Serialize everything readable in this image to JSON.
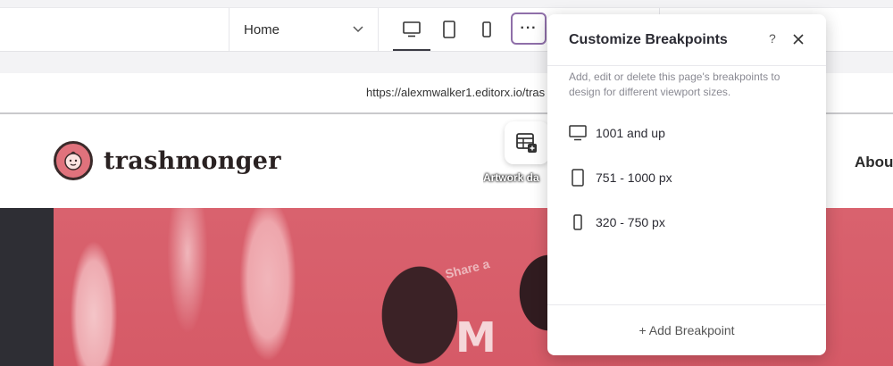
{
  "toolbar": {
    "page_selector": {
      "value": "Home"
    },
    "devices": [
      {
        "name": "desktop",
        "active": true
      },
      {
        "name": "tablet",
        "active": false
      },
      {
        "name": "mobile",
        "active": false
      }
    ],
    "more_label": "···"
  },
  "url_bar": {
    "url": "https://alexmwalker1.editorx.io/tras"
  },
  "site": {
    "logo_text": "trashmonger",
    "artwork_label": "Artwork da",
    "nav_about": "Abou",
    "hero_text": "M",
    "hero_small": "Share a"
  },
  "popover": {
    "title": "Customize Breakpoints",
    "help": "?",
    "description": "Add, edit or delete this page's breakpoints to design for different viewport sizes.",
    "breakpoints": [
      {
        "label": "1001 and up",
        "icon": "desktop-icon"
      },
      {
        "label": "751 - 1000 px",
        "icon": "tablet-icon"
      },
      {
        "label": "320 - 750 px",
        "icon": "mobile-icon"
      }
    ],
    "add_label": "+ Add Breakpoint"
  },
  "colors": {
    "accent_outline": "#8f6fa9",
    "hero_pink": "#d65a67"
  }
}
